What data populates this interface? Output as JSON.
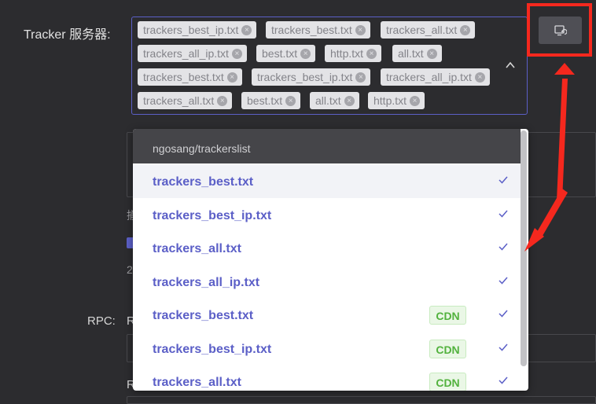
{
  "tracker_label": "Tracker 服务器:",
  "selected_tags": [
    "trackers_best_ip.txt",
    "trackers_best.txt",
    "trackers_all.txt",
    "trackers_all_ip.txt",
    "best.txt",
    "http.txt",
    "all.txt",
    "trackers_best.txt",
    "trackers_best_ip.txt",
    "trackers_all_ip.txt",
    "trackers_all.txt",
    "best.txt",
    "all.txt",
    "http.txt"
  ],
  "dropdown": {
    "group_label": "ngosang/trackerslist",
    "options": [
      {
        "label": "trackers_best.txt",
        "badge": ""
      },
      {
        "label": "trackers_best_ip.txt",
        "badge": ""
      },
      {
        "label": "trackers_all.txt",
        "badge": ""
      },
      {
        "label": "trackers_all_ip.txt",
        "badge": ""
      },
      {
        "label": "trackers_best.txt",
        "badge": "CDN"
      },
      {
        "label": "trackers_best_ip.txt",
        "badge": "CDN"
      },
      {
        "label": "trackers_all.txt",
        "badge": "CDN"
      }
    ]
  },
  "background": {
    "rpc_label": "RPC:",
    "partial_r1": "R",
    "partial_r2": "R",
    "partial_hint": "揃",
    "partial_num": "2"
  },
  "colors": {
    "accent": "#5b5fc7",
    "annotation_red": "#f5281e",
    "cdn_green": "#52b23e"
  }
}
